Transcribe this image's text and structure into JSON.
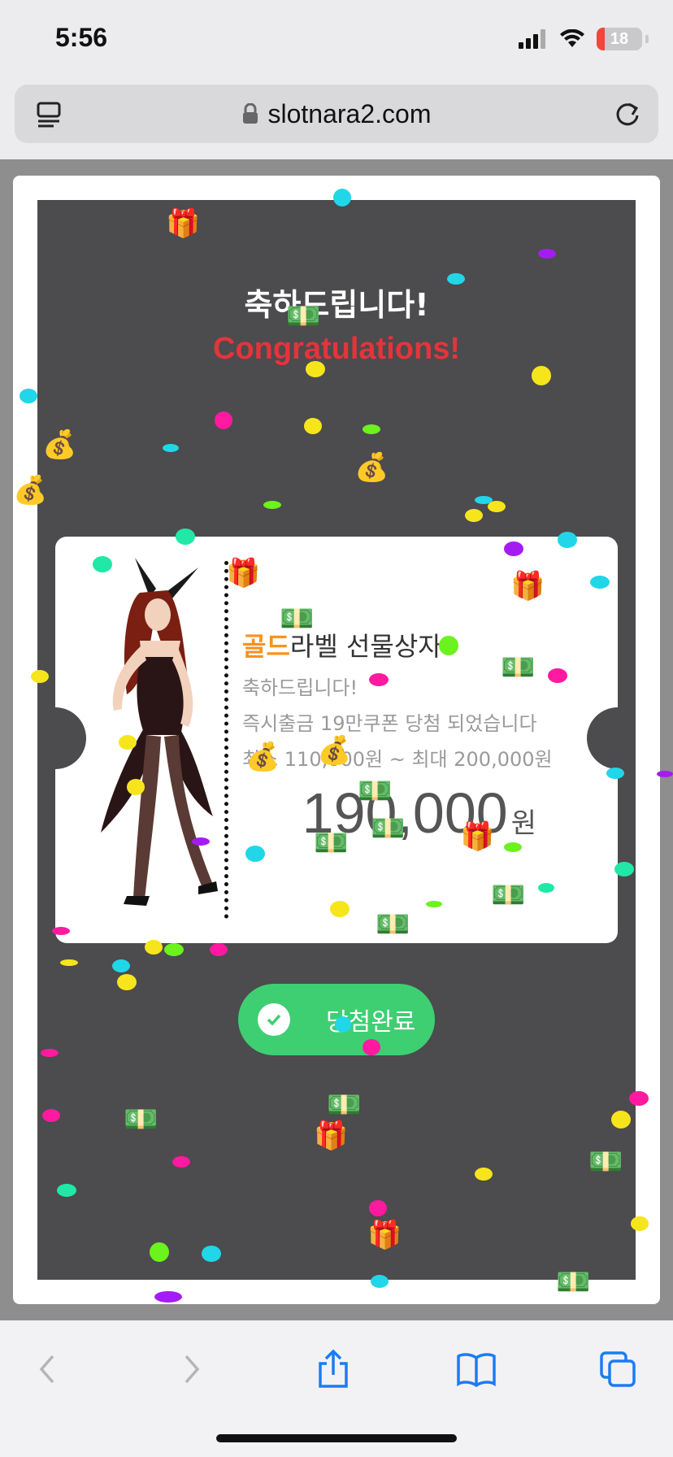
{
  "status_bar": {
    "time": "5:56",
    "battery": "18",
    "battery_color": "#f0463c"
  },
  "browser": {
    "url": "slotnara2.com"
  },
  "modal": {
    "title_kr": "축하드립니다!",
    "title_en": "Congratulations!",
    "ticket": {
      "title_highlight": "골드",
      "title_rest": "라벨 선물상자",
      "line1": "축하드립니다!",
      "line2": "즉시출금 19만쿠폰 당첨 되었습니다",
      "line3": "최소 110,000원 ~ 최대 200,000원",
      "amount": "190,000",
      "unit": "원"
    },
    "button_label": "당첨완료"
  },
  "colors": {
    "accent_gold": "#f7931e",
    "button_green": "#3ecf73",
    "title_red": "#e3343c",
    "modal_dark": "#4c4b4d"
  },
  "icons": [
    "cellular-icon",
    "wifi-icon",
    "battery-icon",
    "lock-icon",
    "tabs-icon",
    "reload-icon",
    "back-icon",
    "forward-icon",
    "share-icon",
    "bookmarks-icon",
    "tab-overview-icon",
    "check-icon",
    "gift-icon",
    "money-bag-icon",
    "banknote-icon"
  ]
}
